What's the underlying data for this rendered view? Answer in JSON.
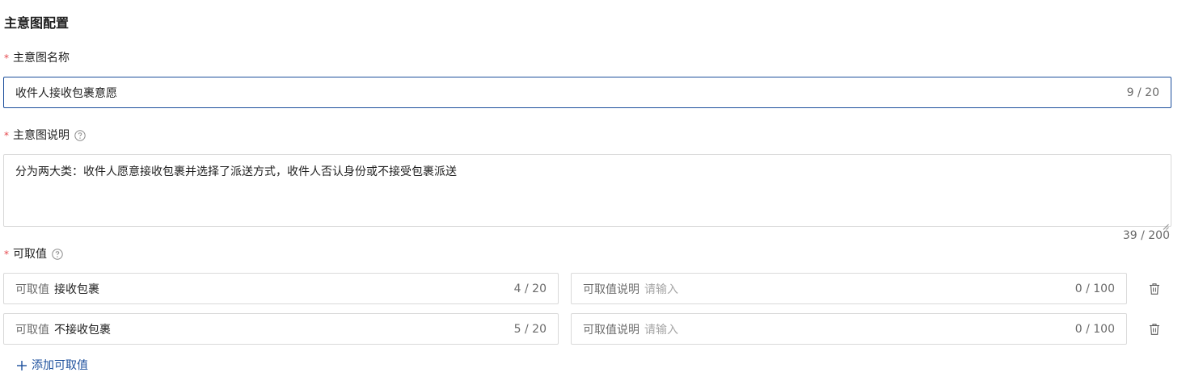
{
  "section": {
    "title": "主意图配置"
  },
  "fields": {
    "name": {
      "required_mark": "*",
      "label": "主意图名称",
      "value": "收件人接收包裹意愿",
      "count": "9 / 20"
    },
    "description": {
      "required_mark": "*",
      "label": "主意图说明",
      "value": "分为两大类：收件人愿意接收包裹并选择了派送方式，收件人否认身份或不接受包裹派送",
      "count": "39 / 200"
    },
    "values": {
      "required_mark": "*",
      "label": "可取值",
      "rows": [
        {
          "value_prefix": "可取值",
          "value": "接收包裹",
          "value_count": "4 / 20",
          "desc_prefix": "可取值说明",
          "desc_placeholder": "请输入",
          "desc_count": "0 / 100"
        },
        {
          "value_prefix": "可取值",
          "value": "不接收包裹",
          "value_count": "5 / 20",
          "desc_prefix": "可取值说明",
          "desc_placeholder": "请输入",
          "desc_count": "0 / 100"
        }
      ],
      "add_label": "添加可取值"
    }
  },
  "colors": {
    "accent": "#1c4f9c",
    "required": "#e5484d",
    "border": "#d9d9d9"
  },
  "icons": {
    "help": "question-circle-icon",
    "delete": "trash-icon",
    "add": "plus-icon"
  }
}
